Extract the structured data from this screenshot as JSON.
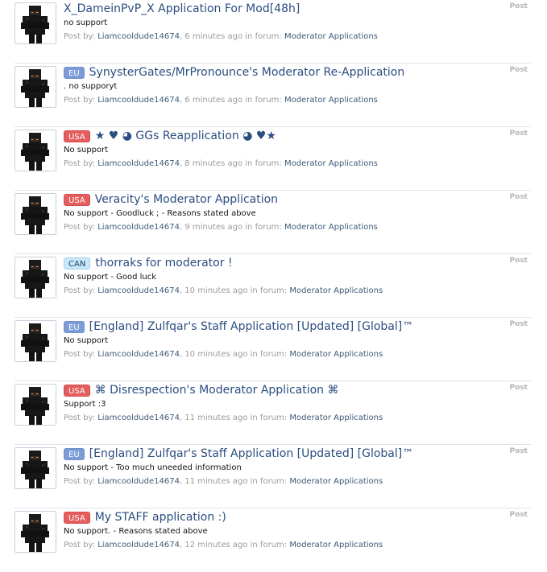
{
  "results": [
    {
      "prefix": "",
      "prefix_class": "",
      "title": "X_DameinPvP_X Application For Mod[48h]",
      "snippet": "no support",
      "post_by_label": "Post by:",
      "author": "Liamcooldude14674",
      "time": "6 minutes ago",
      "in_forum_label": "in forum:",
      "forum": "Moderator Applications",
      "type": "Post"
    },
    {
      "prefix": "EU",
      "prefix_class": "eu",
      "title": "SynysterGates/MrPronounce's Moderator Re-Application",
      "snippet": ". no supporyt",
      "post_by_label": "Post by:",
      "author": "Liamcooldude14674",
      "time": "6 minutes ago",
      "in_forum_label": "in forum:",
      "forum": "Moderator Applications",
      "type": "Post"
    },
    {
      "prefix": "USA",
      "prefix_class": "usa",
      "title": "★ ♥ ◕ GGs Reapplication ◕ ♥★",
      "snippet": "No support",
      "post_by_label": "Post by:",
      "author": "Liamcooldude14674",
      "time": "8 minutes ago",
      "in_forum_label": "in forum:",
      "forum": "Moderator Applications",
      "type": "Post"
    },
    {
      "prefix": "USA",
      "prefix_class": "usa",
      "title": "Veracity's Moderator Application",
      "snippet": "No support - Goodluck ; - Reasons stated above",
      "post_by_label": "Post by:",
      "author": "Liamcooldude14674",
      "time": "9 minutes ago",
      "in_forum_label": "in forum:",
      "forum": "Moderator Applications",
      "type": "Post"
    },
    {
      "prefix": "CAN",
      "prefix_class": "can",
      "title": "thorraks for moderator !",
      "snippet": "No support - Good luck",
      "post_by_label": "Post by:",
      "author": "Liamcooldude14674",
      "time": "10 minutes ago",
      "in_forum_label": "in forum:",
      "forum": "Moderator Applications",
      "type": "Post"
    },
    {
      "prefix": "EU",
      "prefix_class": "eu",
      "title": "[England] Zulfqar's Staff Application [Updated] [Global]™",
      "snippet": "No support",
      "post_by_label": "Post by:",
      "author": "Liamcooldude14674",
      "time": "10 minutes ago",
      "in_forum_label": "in forum:",
      "forum": "Moderator Applications",
      "type": "Post"
    },
    {
      "prefix": "USA",
      "prefix_class": "usa",
      "title": "⌘ Disrespection's Moderator Application ⌘",
      "snippet": "Support :3",
      "post_by_label": "Post by:",
      "author": "Liamcooldude14674",
      "time": "11 minutes ago",
      "in_forum_label": "in forum:",
      "forum": "Moderator Applications",
      "type": "Post"
    },
    {
      "prefix": "EU",
      "prefix_class": "eu",
      "title": "[England] Zulfqar's Staff Application [Updated] [Global]™",
      "snippet": "No support - Too much uneeded information",
      "post_by_label": "Post by:",
      "author": "Liamcooldude14674",
      "time": "11 minutes ago",
      "in_forum_label": "in forum:",
      "forum": "Moderator Applications",
      "type": "Post"
    },
    {
      "prefix": "USA",
      "prefix_class": "usa",
      "title": "My STAFF application :)",
      "snippet": "No support. - Reasons stated above",
      "post_by_label": "Post by:",
      "author": "Liamcooldude14674",
      "time": "12 minutes ago",
      "in_forum_label": "in forum:",
      "forum": "Moderator Applications",
      "type": "Post"
    }
  ],
  "colors": {
    "title_link": "#2b4d80",
    "prefix_eu": "#7c9cd8",
    "prefix_usa": "#e35e5e",
    "prefix_can": "#c7e7fb",
    "meta_text": "#9b9b9b",
    "divider": "#dfe5ec"
  },
  "icons": {
    "avatar": "user-avatar-skin"
  }
}
